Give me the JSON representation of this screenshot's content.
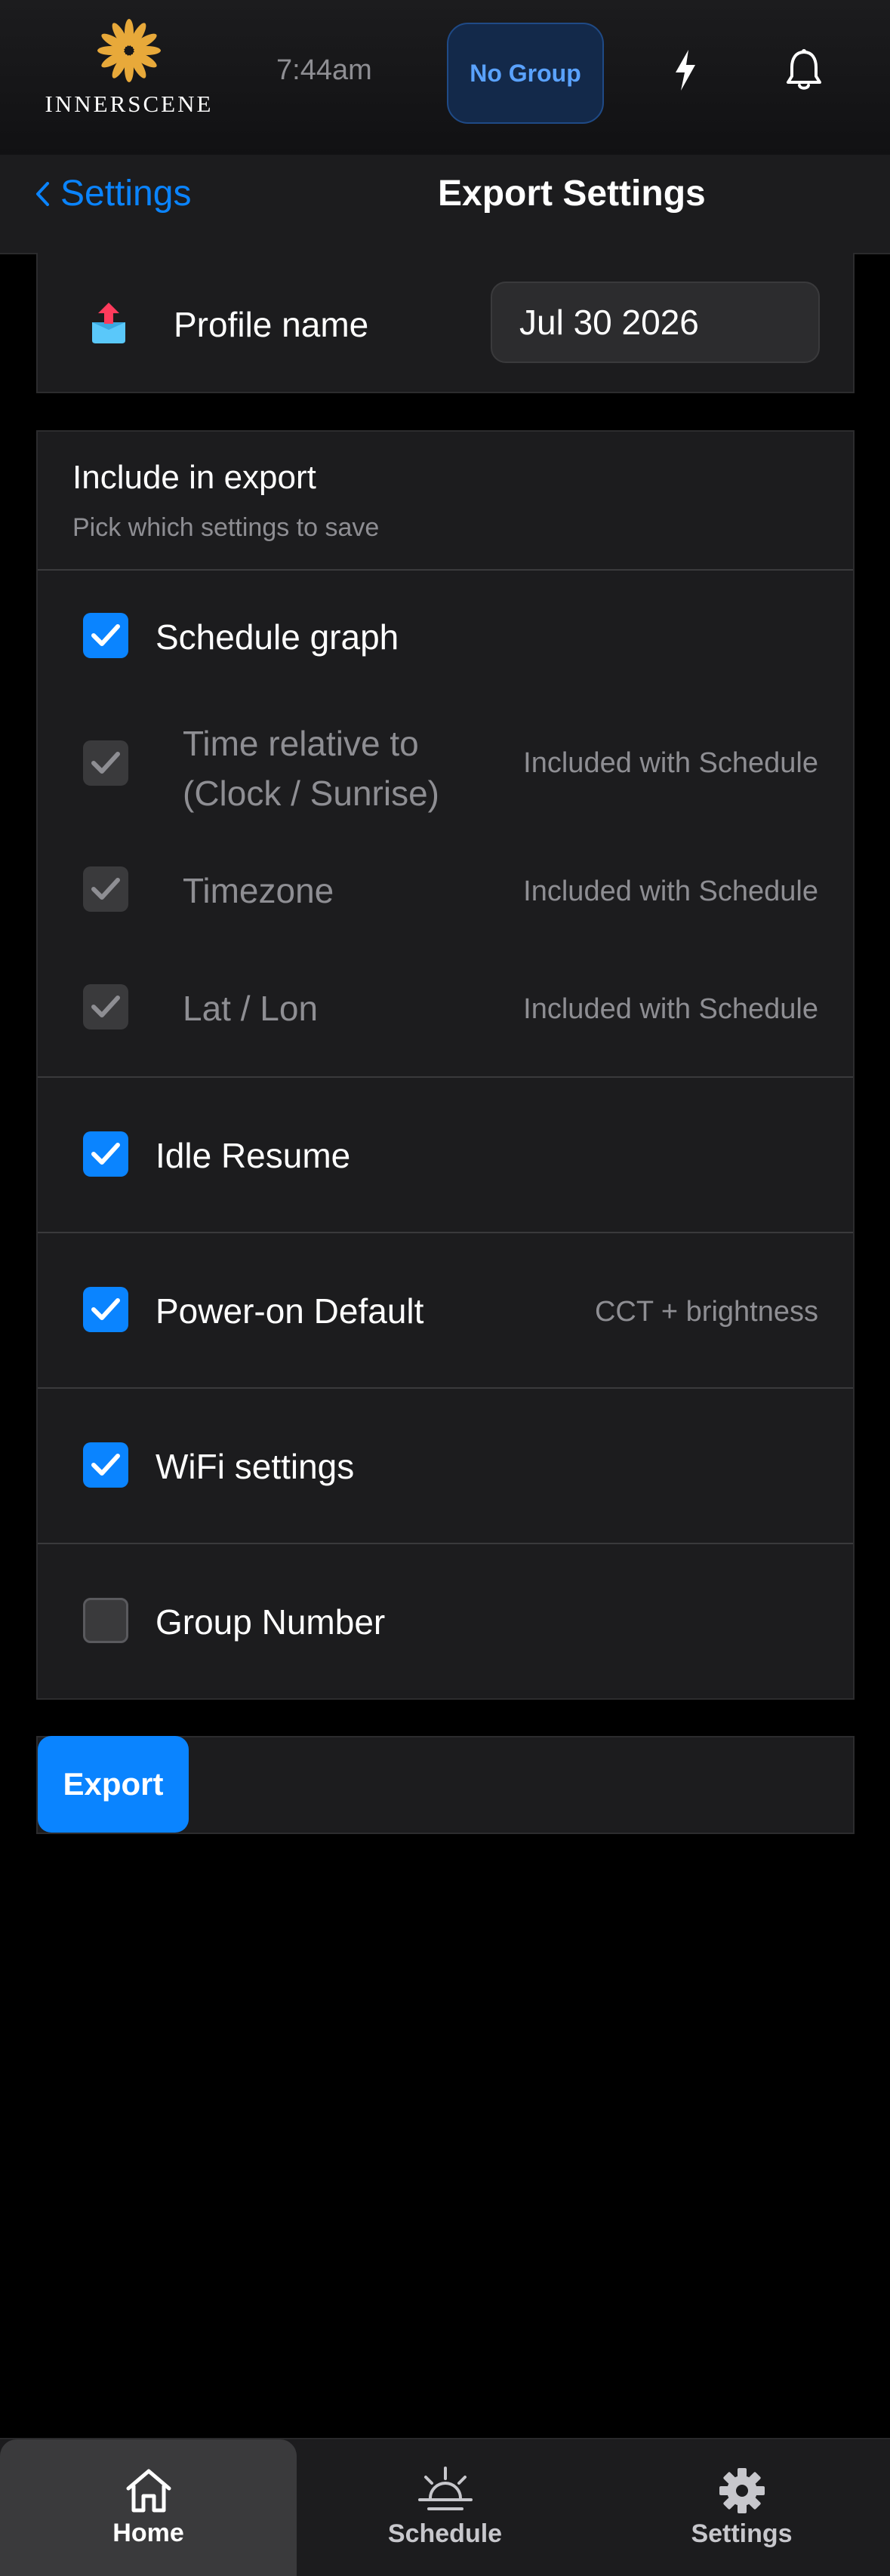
{
  "header": {
    "brand": "INNERSCENE",
    "time": "7:44am",
    "group_label": "No Group",
    "accent_color": "#0a84ff"
  },
  "nav": {
    "back_label": "Settings",
    "title": "Export Settings"
  },
  "profile": {
    "label": "Profile name",
    "value": "Jul 30 2026"
  },
  "include": {
    "title": "Include in export",
    "subtitle": "Pick which settings to save",
    "options": [
      {
        "label": "Schedule graph",
        "checked": true,
        "disabled": false,
        "note": ""
      },
      {
        "label": "Time relative to (Clock / Sunrise)",
        "checked": true,
        "disabled": true,
        "note": "Included with Schedule"
      },
      {
        "label": "Timezone",
        "checked": true,
        "disabled": true,
        "note": "Included with Schedule"
      },
      {
        "label": "Lat / Lon",
        "checked": true,
        "disabled": true,
        "note": "Included with Schedule"
      },
      {
        "label": "Idle Resume",
        "checked": true,
        "disabled": false,
        "note": ""
      },
      {
        "label": "Power-on Default",
        "checked": true,
        "disabled": false,
        "note": "CCT + brightness"
      },
      {
        "label": "WiFi settings",
        "checked": true,
        "disabled": false,
        "note": ""
      },
      {
        "label": "Group Number",
        "checked": false,
        "disabled": false,
        "note": ""
      }
    ]
  },
  "export": {
    "label": "Export"
  },
  "tabs": [
    {
      "label": "Home",
      "icon": "home-icon",
      "active": true
    },
    {
      "label": "Schedule",
      "icon": "sunrise-icon",
      "active": false
    },
    {
      "label": "Settings",
      "icon": "gear-icon",
      "active": false
    }
  ]
}
